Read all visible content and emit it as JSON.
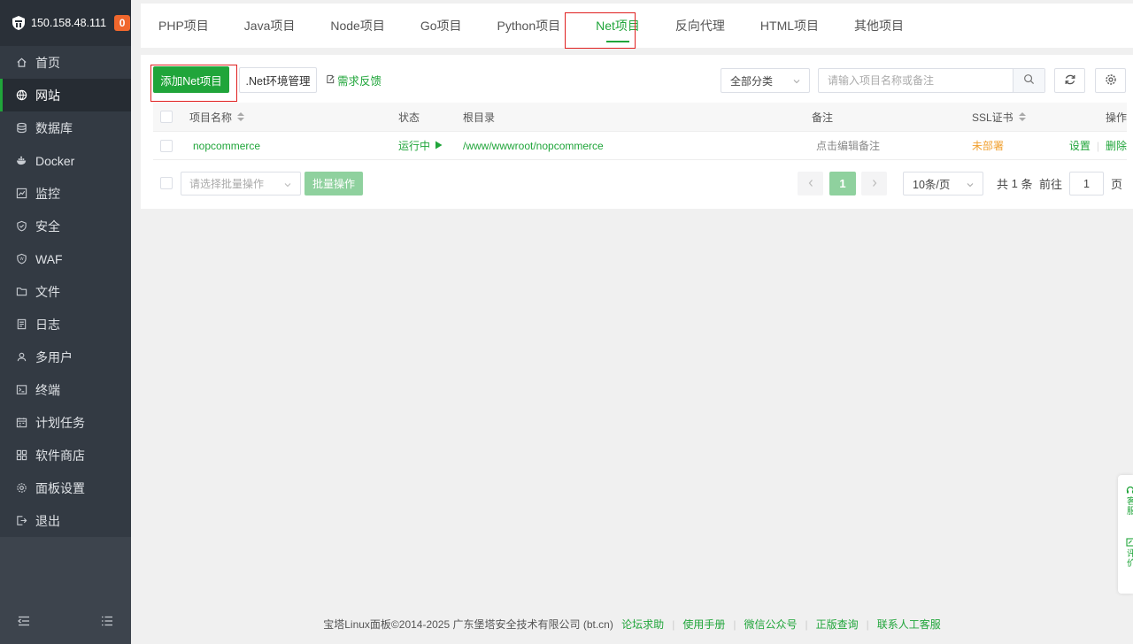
{
  "sidebar": {
    "server_ip": "150.158.48.111",
    "badge": "0",
    "items": [
      {
        "label": "首页",
        "icon": "home-icon"
      },
      {
        "label": "网站",
        "icon": "globe-icon"
      },
      {
        "label": "数据库",
        "icon": "database-icon"
      },
      {
        "label": "Docker",
        "icon": "docker-icon"
      },
      {
        "label": "监控",
        "icon": "monitor-icon"
      },
      {
        "label": "安全",
        "icon": "shield-icon"
      },
      {
        "label": "WAF",
        "icon": "waf-icon"
      },
      {
        "label": "文件",
        "icon": "folder-icon"
      },
      {
        "label": "日志",
        "icon": "log-icon"
      },
      {
        "label": "多用户",
        "icon": "users-icon"
      },
      {
        "label": "终端",
        "icon": "terminal-icon"
      },
      {
        "label": "计划任务",
        "icon": "calendar-icon"
      },
      {
        "label": "软件商店",
        "icon": "apps-icon"
      },
      {
        "label": "面板设置",
        "icon": "gear-icon"
      },
      {
        "label": "退出",
        "icon": "logout-icon"
      }
    ],
    "active_index": 1
  },
  "tabs": {
    "items": [
      "PHP项目",
      "Java项目",
      "Node项目",
      "Go项目",
      "Python项目",
      "Net项目",
      "反向代理",
      "HTML项目",
      "其他项目"
    ],
    "active": "Net项目"
  },
  "toolbar": {
    "add_label": "添加Net项目",
    "env_label": ".Net环境管理",
    "feedback_label": "需求反馈",
    "category_value": "全部分类",
    "search_placeholder": "请输入项目名称或备注"
  },
  "table": {
    "headers": {
      "name": "项目名称",
      "status": "状态",
      "root": "根目录",
      "remark": "备注",
      "ssl": "SSL证书",
      "action": "操作"
    },
    "rows": [
      {
        "name": "nopcommerce",
        "status": "运行中",
        "root": "/www/wwwroot/nopcommerce",
        "remark": "点击编辑备注",
        "ssl": "未部署",
        "action_settings": "设置",
        "action_delete": "删除"
      }
    ]
  },
  "batch": {
    "select_placeholder": "请选择批量操作",
    "button_label": "批量操作"
  },
  "pagination": {
    "current_page": "1",
    "page_size": "10条/页",
    "total_prefix": "共",
    "total": "1",
    "total_suffix": "条",
    "goto_prefix": "前往",
    "goto_value": "1",
    "goto_suffix": "页"
  },
  "footer": {
    "copyright": "宝塔Linux面板©2014-2025 广东堡塔安全技术有限公司 (bt.cn)",
    "links": [
      "论坛求助",
      "使用手册",
      "微信公众号",
      "正版查询",
      "联系人工客服"
    ]
  },
  "float": {
    "item1": "客服",
    "item2": "评价"
  },
  "colors": {
    "accent": "#20a53a",
    "sidebar_bg": "#333a43",
    "badge": "#f0672d",
    "highlight_box": "#e02020",
    "ssl_warning": "#f0a030"
  }
}
